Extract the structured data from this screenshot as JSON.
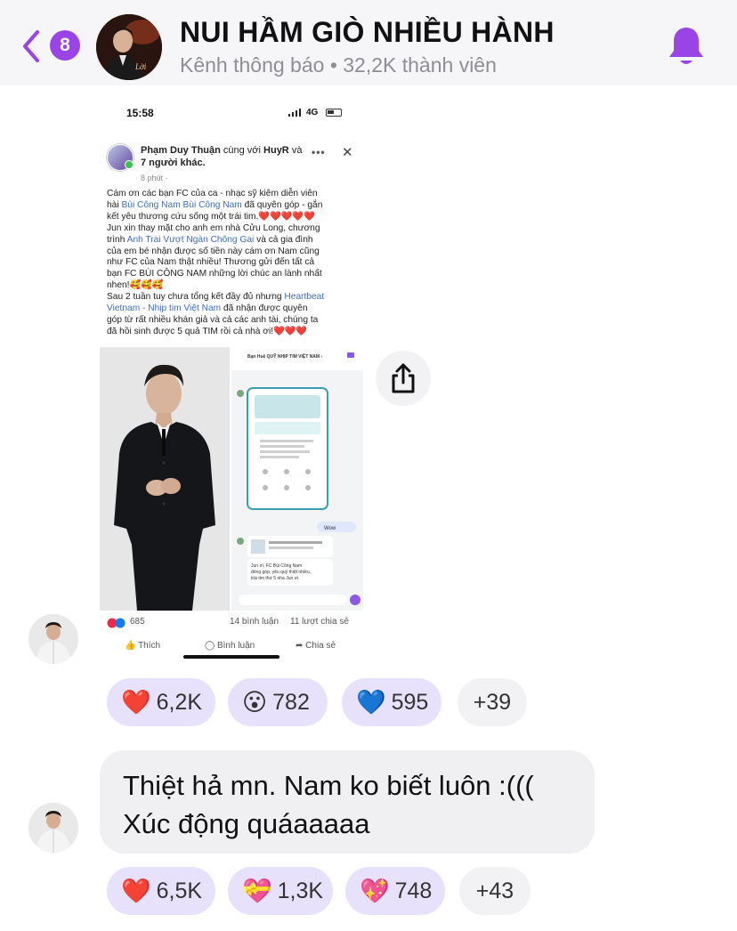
{
  "header": {
    "back_count": "8",
    "title": "NUI HẦM GIÒ NHIỀU HÀNH",
    "subtitle": "Kênh thông báo • 32,2K thành viên",
    "accent": "#9b44e6"
  },
  "screenshot": {
    "status_time": "15:58",
    "status_network": "4G",
    "post": {
      "author_line1": "Phạm Duy Thuận",
      "author_mid": " cùng với ",
      "author_tag": "HuyR",
      "author_tail": " và",
      "author_line2": "7 người khác.",
      "time": "8 phút ·",
      "body": [
        {
          "t": "Cám ơn các bạn FC của ca - nhạc sỹ kiêm diễn viên"
        },
        {
          "t": "hài ",
          "link": "Bùi Công Nam Bùi Công Nam",
          "after": " đã quyên góp - gắn"
        },
        {
          "t": "kết yêu thương cứu sống một trái tim.❤️❤️❤️❤️❤️"
        },
        {
          "t": "Jun xin thay mặt cho anh em nhà Cửu Long, chương"
        },
        {
          "t": "trình ",
          "link": "Anh Trai Vượt Ngàn Chông Gai",
          "after": " và cả gia đình"
        },
        {
          "t": "của em bé nhận được số tiền này cám ơn Nam cũng"
        },
        {
          "t": "như FC của Nam thật nhiều! Thương gửi đến tất cả"
        },
        {
          "t": "bạn FC BÙI CÔNG NAM những lời chúc an lành nhất"
        },
        {
          "t": "nhen!🥰🥰🥰"
        },
        {
          "t": "Sau 2 tuần tuy chưa tổng kết đầy đủ nhưng ",
          "link": "Heartbeat"
        },
        {
          "t": "",
          "link": "Vietnam - Nhịp tim Việt Nam",
          "after": " đã nhận được quyên"
        },
        {
          "t": "góp từ rất nhiều khán giả và cả các anh tài, chúng ta"
        },
        {
          "t": "đã hồi sinh được 5 quả TIM rồi cả nhà ơi!❤️❤️❤️"
        }
      ],
      "chat_header": "Bạn Huệ QUỸ NHỊP TIM VIỆT NAM ›",
      "chat_reply_tag": "Wow",
      "chat_msg": "Jun ơi, FC Bùi Công Nam đóng góp, yêu quý thiệt nhiều, trái tim thứ 5 nha Jun ơi",
      "reaction_count": "685",
      "comments": "14 bình luận",
      "shares": "11 lượt chia sẻ",
      "action_like": "Thích",
      "action_comment": "Bình luận",
      "action_share": "Chia sẻ"
    }
  },
  "messages": [
    {
      "reactions": [
        {
          "emoji": "❤️",
          "count": "6,2K"
        },
        {
          "emoji": "😮",
          "count": "782"
        },
        {
          "emoji": "💙",
          "count": "595"
        }
      ],
      "more": "+39"
    },
    {
      "text_line1": "Thiệt hả mn. Nam ko biết luôn :(((",
      "text_line2": "Xúc động quáaaaaa",
      "reactions": [
        {
          "emoji": "❤️",
          "count": "6,5K"
        },
        {
          "emoji": "💝",
          "count": "1,3K"
        },
        {
          "emoji": "💖",
          "count": "748"
        }
      ],
      "more": "+43"
    }
  ]
}
